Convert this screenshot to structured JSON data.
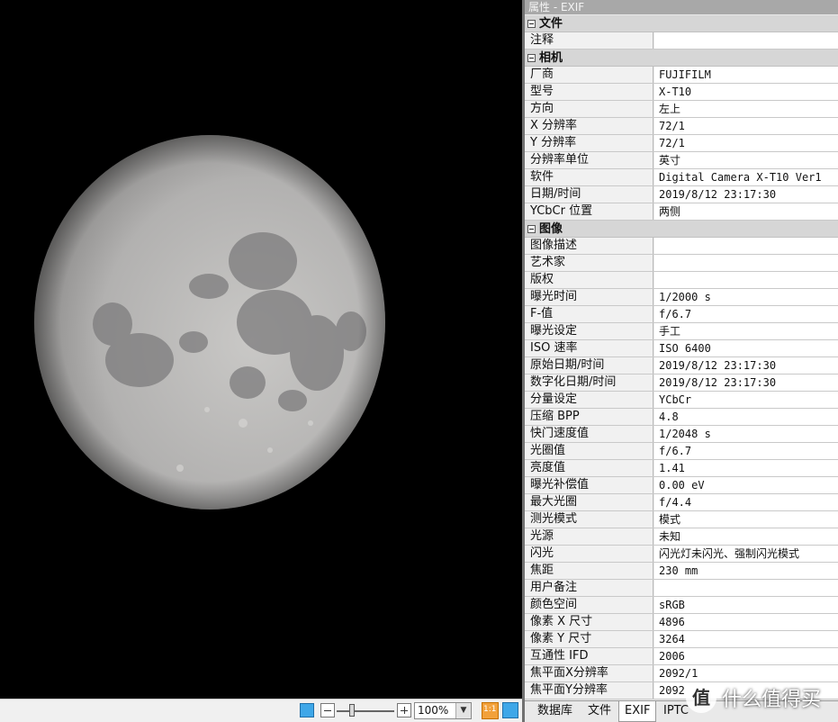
{
  "panel": {
    "title": "属性 - EXIF"
  },
  "sections": [
    {
      "title": "文件",
      "rows": [
        {
          "key": "注释",
          "value": ""
        }
      ]
    },
    {
      "title": "相机",
      "rows": [
        {
          "key": "厂商",
          "value": "FUJIFILM"
        },
        {
          "key": "型号",
          "value": "X-T10"
        },
        {
          "key": "方向",
          "value": "左上"
        },
        {
          "key": "X 分辨率",
          "value": "72/1"
        },
        {
          "key": "Y 分辨率",
          "value": "72/1"
        },
        {
          "key": "分辨率单位",
          "value": "英寸"
        },
        {
          "key": "软件",
          "value": "Digital Camera X-T10 Ver1"
        },
        {
          "key": "日期/时间",
          "value": "2019/8/12 23:17:30"
        },
        {
          "key": "YCbCr 位置",
          "value": "两侧"
        }
      ]
    },
    {
      "title": "图像",
      "rows": [
        {
          "key": "图像描述",
          "value": ""
        },
        {
          "key": "艺术家",
          "value": ""
        },
        {
          "key": "版权",
          "value": ""
        },
        {
          "key": "曝光时间",
          "value": "1/2000 s"
        },
        {
          "key": "F-值",
          "value": "f/6.7"
        },
        {
          "key": "曝光设定",
          "value": "手工"
        },
        {
          "key": "ISO 速率",
          "value": "ISO 6400"
        },
        {
          "key": "原始日期/时间",
          "value": "2019/8/12 23:17:30"
        },
        {
          "key": "数字化日期/时间",
          "value": "2019/8/12 23:17:30"
        },
        {
          "key": "分量设定",
          "value": "YCbCr"
        },
        {
          "key": "压缩 BPP",
          "value": "4.8"
        },
        {
          "key": "快门速度值",
          "value": "1/2048 s"
        },
        {
          "key": "光圈值",
          "value": "f/6.7"
        },
        {
          "key": "亮度值",
          "value": "1.41"
        },
        {
          "key": "曝光补偿值",
          "value": "0.00 eV"
        },
        {
          "key": "最大光圈",
          "value": "f/4.4"
        },
        {
          "key": "测光模式",
          "value": "模式"
        },
        {
          "key": "光源",
          "value": "未知"
        },
        {
          "key": "闪光",
          "value": "闪光灯未闪光、强制闪光模式"
        },
        {
          "key": "焦距",
          "value": "230 mm"
        },
        {
          "key": "用户备注",
          "value": ""
        },
        {
          "key": "颜色空间",
          "value": "sRGB"
        },
        {
          "key": "像素 X 尺寸",
          "value": "4896"
        },
        {
          "key": "像素 Y 尺寸",
          "value": "3264"
        },
        {
          "key": "互通性 IFD",
          "value": "2006"
        },
        {
          "key": "焦平面X分辨率",
          "value": "2092/1"
        },
        {
          "key": "焦平面Y分辨率",
          "value": "2092"
        }
      ]
    }
  ],
  "tabs": [
    {
      "label": "数据库",
      "active": false
    },
    {
      "label": "文件",
      "active": false
    },
    {
      "label": "EXIF",
      "active": true
    },
    {
      "label": "IPTC",
      "active": false
    }
  ],
  "statusbar": {
    "zoom": "100%",
    "actual_size_label": "1:1"
  },
  "watermark": {
    "logo": "值",
    "text": "什么值得买"
  }
}
